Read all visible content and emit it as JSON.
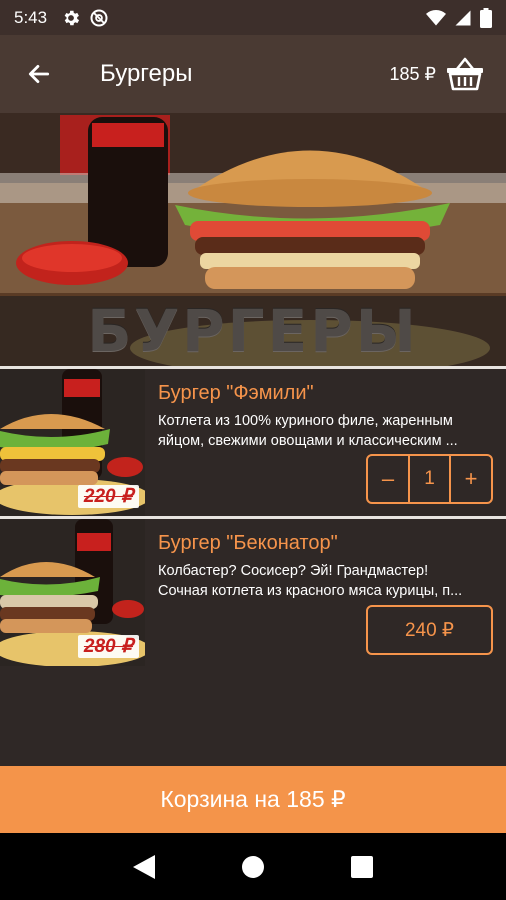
{
  "status_bar": {
    "time": "5:43",
    "icons": [
      "gear-icon",
      "at-sign-icon",
      "wifi-icon",
      "signal-icon",
      "battery-icon"
    ]
  },
  "app_bar": {
    "title": "Бургеры",
    "price": "185 ₽",
    "back_icon": "arrow-left-icon",
    "basket_icon": "basket-icon"
  },
  "hero": {
    "banner_text": "БУРГЕРЫ"
  },
  "items": [
    {
      "name": "Бургер \"Фэмили\"",
      "desc_line1": "Котлета из 100% куриного филе, жаренным",
      "desc_line2": "яйцом, свежими овощами и классическим ...",
      "image_label": "Coca-Cola",
      "old_price": "220 ₽",
      "quantity": "1",
      "minus": "–",
      "plus": "+"
    },
    {
      "name": "Бургер \"Беконатор\"",
      "desc_line1": "Колбастер? Сосисер? Эй! Грандмастер!",
      "desc_line2": "Сочная котлета из красного мяса курицы, п...",
      "image_label": "Coca-Cola",
      "old_price": "280 ₽",
      "price": "240 ₽"
    }
  ],
  "cart": {
    "label": "Корзина на 185 ₽"
  },
  "nav": {
    "icons": [
      "back-triangle-icon",
      "home-circle-icon",
      "recents-square-icon"
    ]
  },
  "colors": {
    "accent": "#f4944a",
    "app_bar": "#4a3a33",
    "background": "#2f2826",
    "old_price_red": "#c8201e"
  }
}
